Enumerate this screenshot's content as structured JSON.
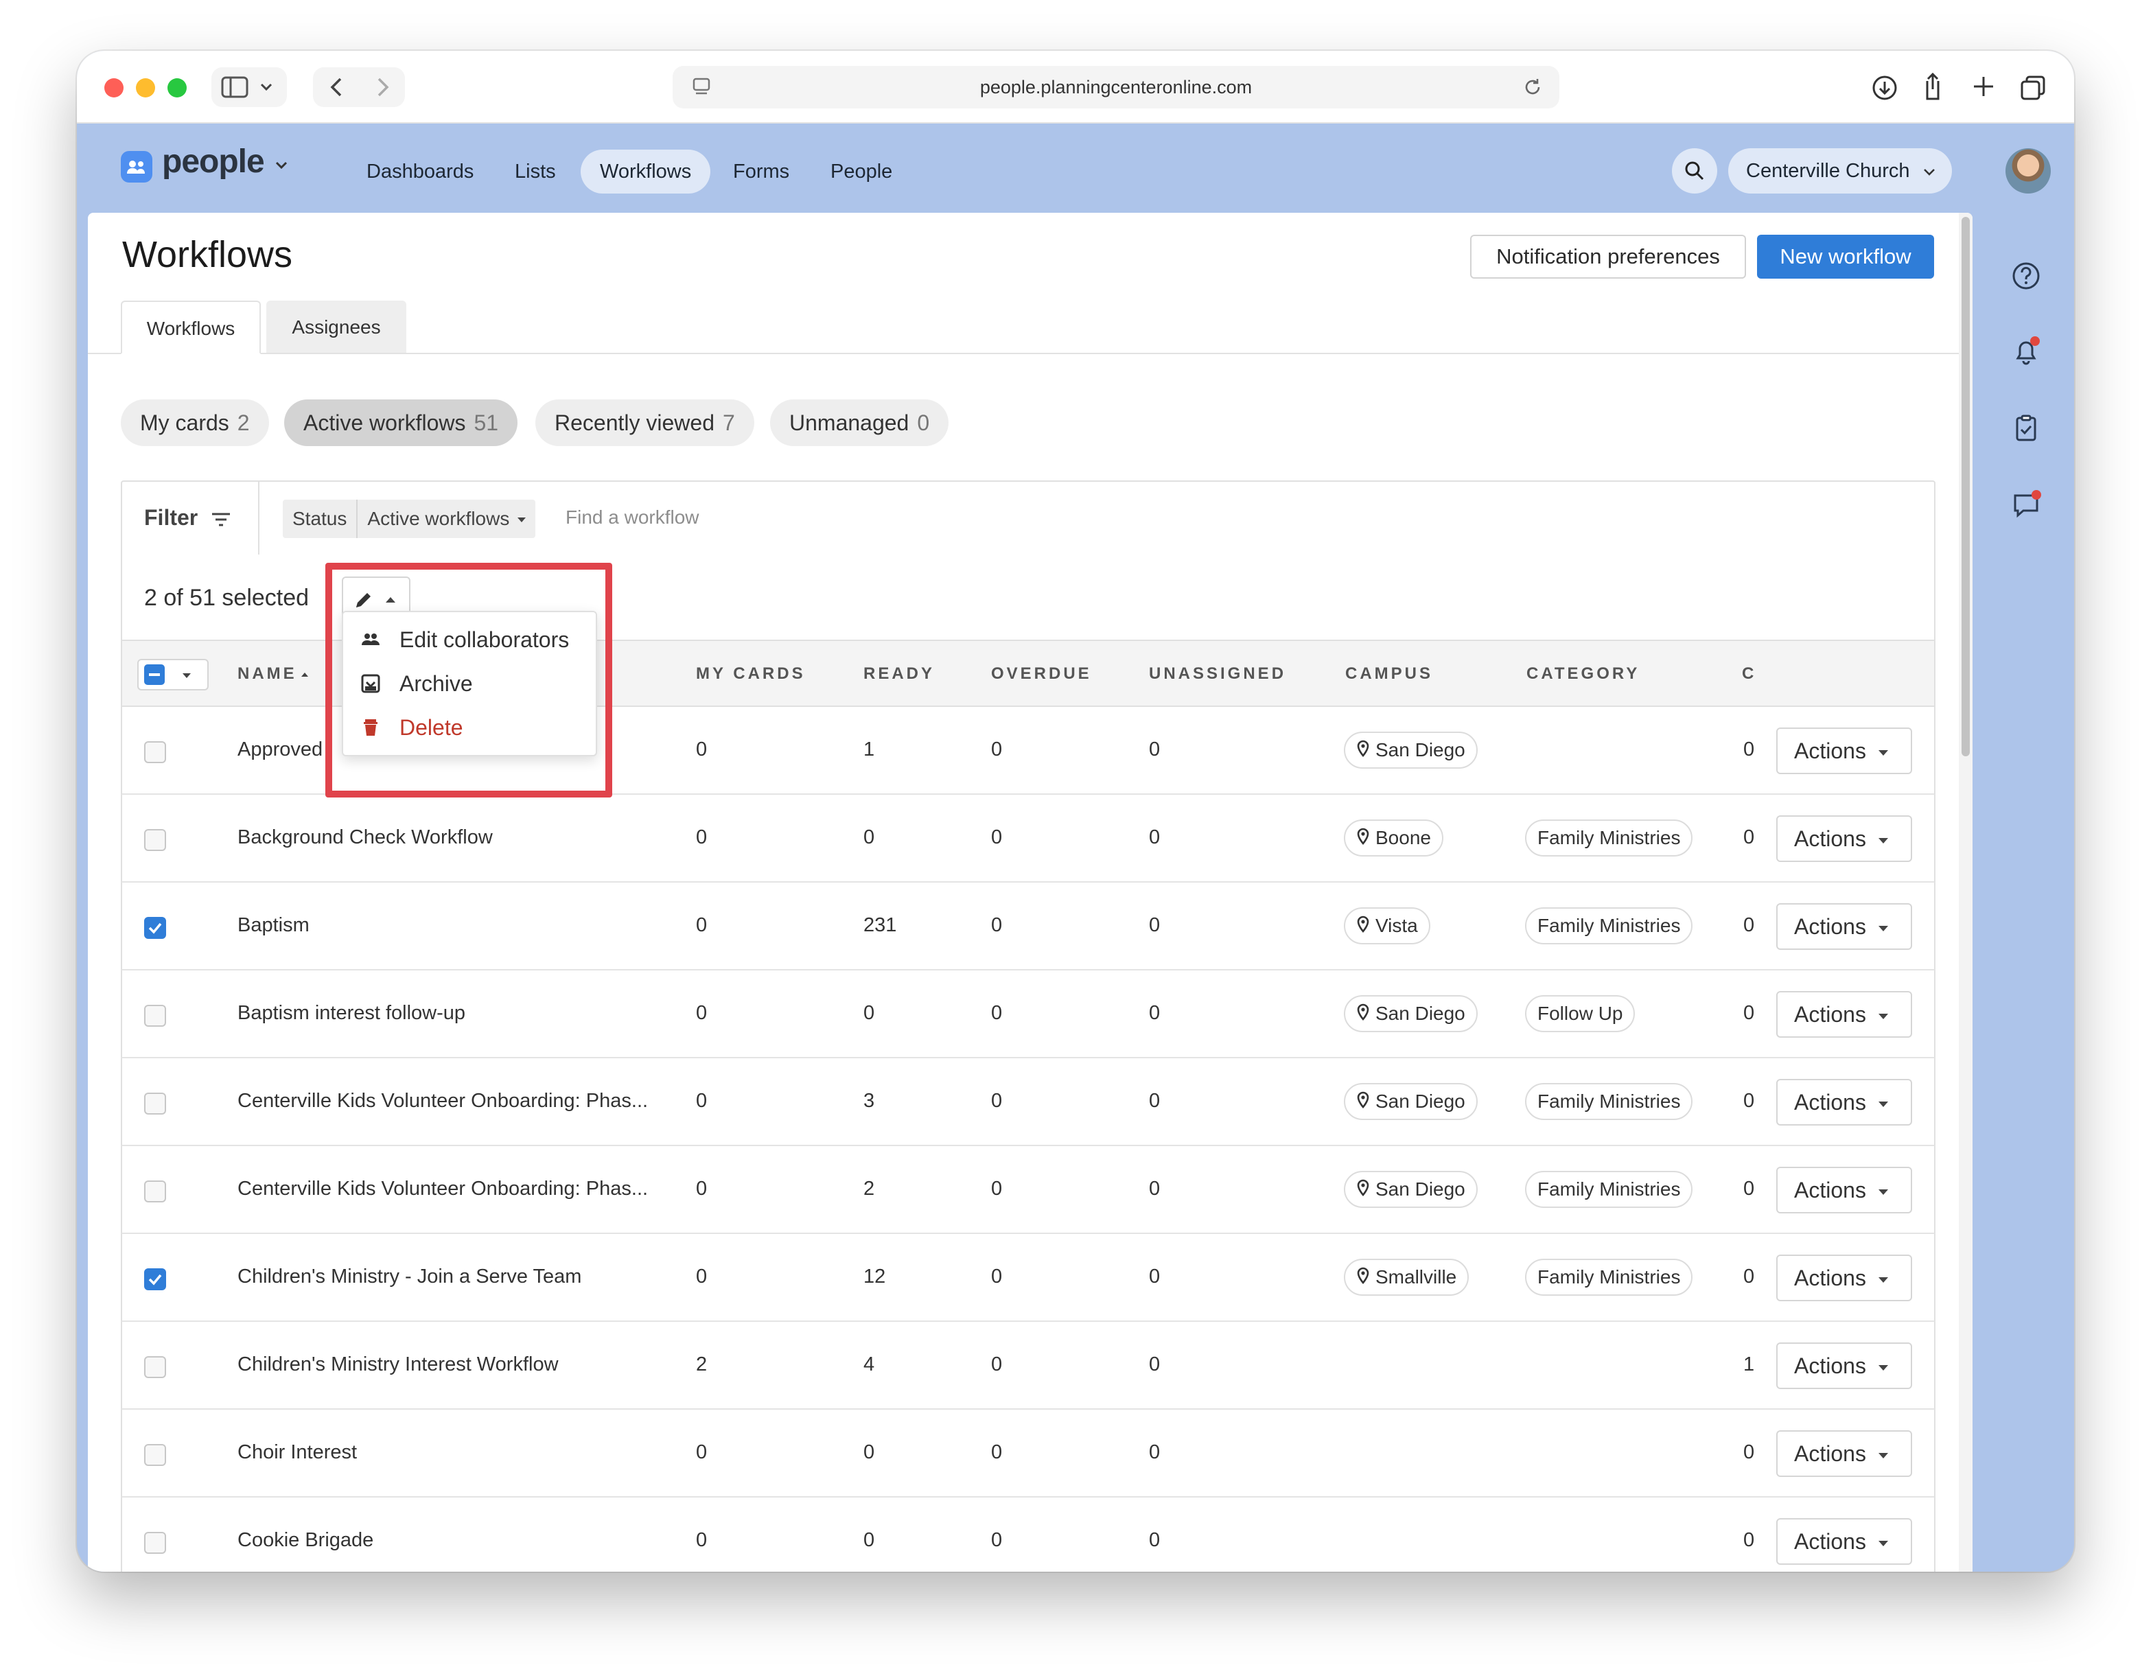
{
  "browser": {
    "url": "people.planningcenteronline.com"
  },
  "app": {
    "logo_text": "people",
    "nav": [
      "Dashboards",
      "Lists",
      "Workflows",
      "Forms",
      "People"
    ],
    "active_nav": "Workflows",
    "org_name": "Centerville Church"
  },
  "page": {
    "title": "Workflows",
    "notif_button": "Notification preferences",
    "new_button": "New workflow",
    "tabs": [
      "Workflows",
      "Assignees"
    ],
    "chips": [
      {
        "label": "My cards",
        "count": "2"
      },
      {
        "label": "Active workflows",
        "count": "51"
      },
      {
        "label": "Recently viewed",
        "count": "7"
      },
      {
        "label": "Unmanaged",
        "count": "0"
      }
    ]
  },
  "filter": {
    "label": "Filter",
    "status_key": "Status",
    "status_value": "Active workflows",
    "search_placeholder": "Find a workflow"
  },
  "selection": {
    "text": "2 of 51 selected"
  },
  "menu": {
    "items": [
      "Edit collaborators",
      "Archive",
      "Delete"
    ]
  },
  "table": {
    "headers": [
      "NAME",
      "MY CARDS",
      "READY",
      "OVERDUE",
      "UNASSIGNED",
      "CAMPUS",
      "CATEGORY",
      "C"
    ],
    "action_label": "Actions",
    "rows": [
      {
        "name": "Approved",
        "my_cards": "0",
        "ready": "1",
        "overdue": "0",
        "unassigned": "0",
        "campus": "San Diego",
        "category": "",
        "c": "0",
        "checked": false
      },
      {
        "name": "Background Check Workflow",
        "my_cards": "0",
        "ready": "0",
        "overdue": "0",
        "unassigned": "0",
        "campus": "Boone",
        "category": "Family Ministries",
        "c": "0",
        "checked": false
      },
      {
        "name": "Baptism",
        "my_cards": "0",
        "ready": "231",
        "overdue": "0",
        "unassigned": "0",
        "campus": "Vista",
        "category": "Family Ministries",
        "c": "0",
        "checked": true
      },
      {
        "name": "Baptism interest follow-up",
        "my_cards": "0",
        "ready": "0",
        "overdue": "0",
        "unassigned": "0",
        "campus": "San Diego",
        "category": "Follow Up",
        "c": "0",
        "checked": false
      },
      {
        "name": "Centerville Kids Volunteer Onboarding: Phas...",
        "my_cards": "0",
        "ready": "3",
        "overdue": "0",
        "unassigned": "0",
        "campus": "San Diego",
        "category": "Family Ministries",
        "c": "0",
        "checked": false
      },
      {
        "name": "Centerville Kids Volunteer Onboarding: Phas...",
        "my_cards": "0",
        "ready": "2",
        "overdue": "0",
        "unassigned": "0",
        "campus": "San Diego",
        "category": "Family Ministries",
        "c": "0",
        "checked": false
      },
      {
        "name": "Children's Ministry - Join a Serve Team",
        "my_cards": "0",
        "ready": "12",
        "overdue": "0",
        "unassigned": "0",
        "campus": "Smallville",
        "category": "Family Ministries",
        "c": "0",
        "checked": true
      },
      {
        "name": "Children's Ministry Interest Workflow",
        "my_cards": "2",
        "ready": "4",
        "overdue": "0",
        "unassigned": "0",
        "campus": "",
        "category": "",
        "c": "1",
        "checked": false
      },
      {
        "name": "Choir Interest",
        "my_cards": "0",
        "ready": "0",
        "overdue": "0",
        "unassigned": "0",
        "campus": "",
        "category": "",
        "c": "0",
        "checked": false
      },
      {
        "name": "Cookie Brigade",
        "my_cards": "0",
        "ready": "0",
        "overdue": "0",
        "unassigned": "0",
        "campus": "",
        "category": "",
        "c": "0",
        "checked": false
      }
    ]
  },
  "colors": {
    "primary": "#2f7dd8",
    "danger": "#c0392b",
    "highlight": "#e0434b",
    "app_bg": "#adc4ea"
  },
  "icons": [
    "sidebar-icon",
    "chevron-down-icon",
    "back-icon",
    "forward-icon",
    "reload-icon",
    "download-icon",
    "share-icon",
    "plus-icon",
    "tabs-icon",
    "search-icon",
    "help-icon",
    "bell-icon",
    "clipboard-icon",
    "chat-icon",
    "filter-icon",
    "pencil-icon",
    "people-icon",
    "archive-icon",
    "trash-icon",
    "pin-icon"
  ]
}
